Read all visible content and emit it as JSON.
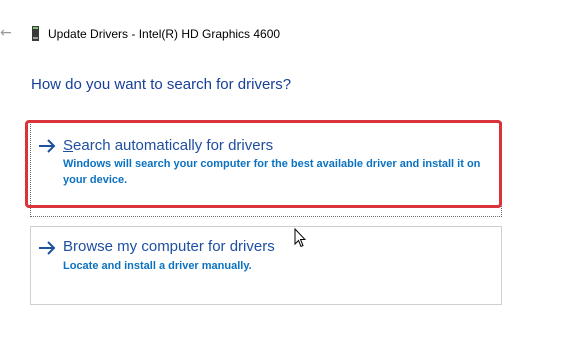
{
  "window": {
    "title": "Update Drivers - Intel(R) HD Graphics 4600",
    "back_icon": "back-arrow-icon",
    "app_icon": "device-icon"
  },
  "main": {
    "heading": "How do you want to search for drivers?",
    "options": [
      {
        "title_underlined_letter": "S",
        "title_rest": "earch automatically for drivers",
        "description": "Windows will search your computer for the best available driver and install it on your device.",
        "icon": "arrow-right-icon"
      },
      {
        "title_underlined_letter": "",
        "title_rest": "Browse my computer for drivers",
        "description": "Locate and install a driver manually.",
        "icon": "arrow-right-icon"
      }
    ]
  },
  "colors": {
    "heading": "#16409a",
    "option_title": "#1e4fa0",
    "option_desc": "#0b72c1",
    "highlight": "#d9343a"
  }
}
